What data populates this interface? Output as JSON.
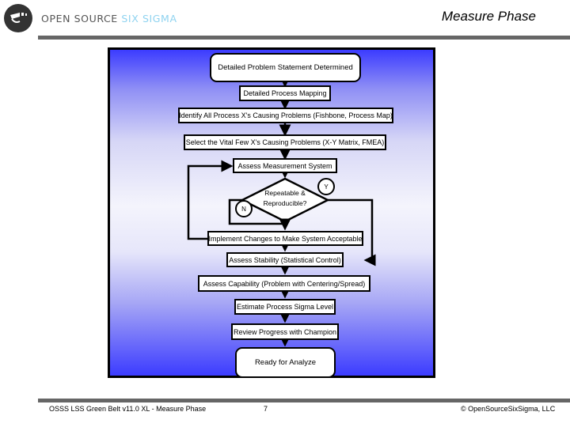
{
  "header": {
    "brand_main": "OPEN SOURCE ",
    "brand_accent": "SIX SIGMA",
    "title": "Measure Phase",
    "logo_icon": "open-source-six-sigma-logo"
  },
  "flowchart": {
    "start": "Detailed Problem Statement Determined",
    "steps": [
      "Detailed Process Mapping",
      "Identify All Process X's Causing Problems (Fishbone, Process Map)",
      "Select the Vital Few X's Causing Problems (X-Y Matrix, FMEA)",
      "Assess Measurement System"
    ],
    "decision": {
      "line1": "Repeatable &",
      "line2": "Reproducible?",
      "yes_label": "Y",
      "no_label": "N"
    },
    "fix_step": "Implement Changes to Make System Acceptable",
    "later_steps": [
      "Assess Stability (Statistical Control)",
      "Assess Capability (Problem with Centering/Spread)",
      "Estimate Process Sigma Level",
      "Review Progress with Champion"
    ],
    "end": "Ready for Analyze"
  },
  "footer": {
    "course": "OSSS LSS Green Belt v11.0 XL - Measure Phase",
    "page": "7",
    "copyright": "© OpenSourceSixSigma, LLC"
  }
}
